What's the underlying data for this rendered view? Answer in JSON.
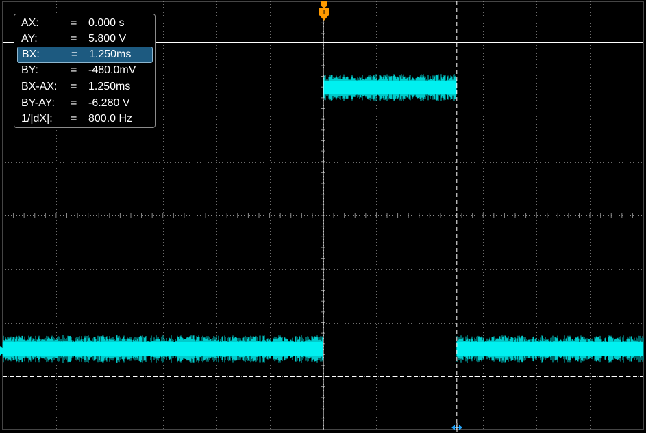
{
  "colors": {
    "trace": "#00f0f0",
    "grid": "#8a8a8a",
    "cursor_a": "#ffffff",
    "cursor_b_x": "#ffffff",
    "trigger_marker": "#ff9a00",
    "cursor_b_marker": "#22a6ff",
    "selected_row_bg": "#1d5a80"
  },
  "icons": {
    "trigger_marker": "trigger-position-icon",
    "cursor_b_marker": "cursor-b-position-icon",
    "channel_marker": "channel-1-offset-icon"
  },
  "cursor_readout": {
    "rows": [
      {
        "label": "AX:",
        "eq": "=",
        "value": "0.000 s",
        "selected": false
      },
      {
        "label": "AY:",
        "eq": "=",
        "value": "5.800 V",
        "selected": false
      },
      {
        "label": "BX:",
        "eq": "=",
        "value": "1.250ms",
        "selected": true
      },
      {
        "label": "BY:",
        "eq": "=",
        "value": "-480.0mV",
        "selected": false
      },
      {
        "label": "BX-AX:",
        "eq": "=",
        "value": "1.250ms",
        "selected": false
      },
      {
        "label": "BY-AY:",
        "eq": "=",
        "value": "-6.280 V",
        "selected": false
      },
      {
        "label": "1/|dX|:",
        "eq": "=",
        "value": "800.0 Hz",
        "selected": false
      }
    ]
  },
  "waveform": {
    "time_per_div_ms": 0.5,
    "volts_per_div": 2,
    "high_level_v": 6.0,
    "low_level_v": -0.5,
    "rising_edge_ms": 0.0,
    "falling_edge_ms": 1.25,
    "cursor_a_time_ms": 0.0,
    "cursor_a_volts": 5.8,
    "cursor_b_time_ms": 1.25,
    "cursor_b_volts": -0.48
  }
}
